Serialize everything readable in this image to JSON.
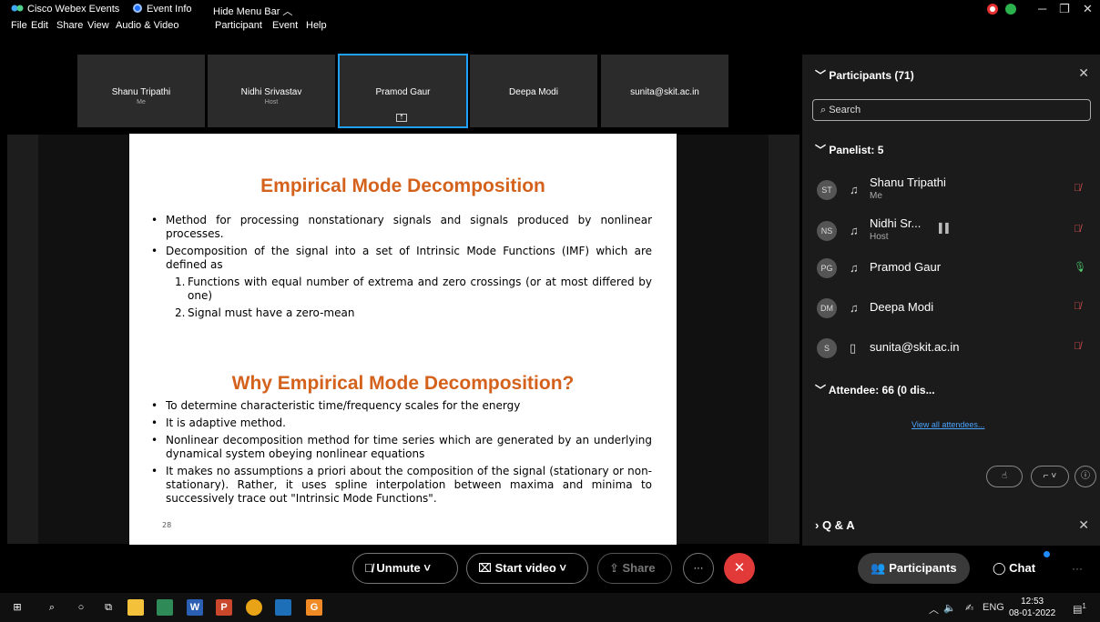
{
  "titlebar": {
    "app_title": "Cisco Webex Events",
    "event_info": "Event Info",
    "hide_menu": "Hide Menu Bar ︿"
  },
  "menu": [
    "File",
    "Edit",
    "Share",
    "View",
    "Audio & Video",
    "Participant",
    "Event",
    "Help"
  ],
  "tiles": [
    {
      "name": "Shanu Tripathi",
      "sub": "Me"
    },
    {
      "name": "Nidhi Srivastav",
      "sub": "Host"
    },
    {
      "name": "Pramod Gaur",
      "sub": ""
    },
    {
      "name": "Deepa Modi",
      "sub": ""
    },
    {
      "name": "sunita@skit.ac.in",
      "sub": ""
    }
  ],
  "slide": {
    "title1": "Empirical Mode Decomposition",
    "bullets1": [
      "Method for processing nonstationary signals and signals produced by nonlinear processes.",
      "Decomposition of the signal into a set of  Intrinsic Mode Functions (IMF) which are defined as"
    ],
    "numbered": [
      {
        "n": "1.",
        "text": "Functions with equal number of extrema and zero crossings (or at most differed by one)"
      },
      {
        "n": "2.",
        "text": "Signal must have a zero-mean"
      }
    ],
    "title2": "Why Empirical Mode Decomposition?",
    "bullets2": [
      "To determine characteristic time/frequency scales for the energy",
      "It is adaptive method.",
      "Nonlinear decomposition method for time series which are generated by an underlying dynamical system obeying nonlinear equations",
      "It makes no assumptions a priori about the composition of the signal (stationary or non-stationary). Rather, it uses spline interpolation between maxima and minima to successively trace out \"Intrinsic Mode Functions\"."
    ],
    "page_number": "28"
  },
  "toolbar": {
    "unmute": "Unmute",
    "start_video": "Start video",
    "share": "Share",
    "participants": "Participants",
    "chat": "Chat"
  },
  "panel": {
    "header": "Participants (71)",
    "search_placeholder": "Search",
    "panelist_header": "Panelist: 5",
    "panelists": [
      {
        "initials": "ST",
        "name": "Shanu Tripathi",
        "role": "Me",
        "mic": "muted"
      },
      {
        "initials": "NS",
        "name": "Nidhi Sr...",
        "role": "Host",
        "mic": "muted"
      },
      {
        "initials": "PG",
        "name": "Pramod Gaur",
        "role": "",
        "mic": "on"
      },
      {
        "initials": "DM",
        "name": "Deepa Modi",
        "role": "",
        "mic": "muted"
      },
      {
        "initials": "S",
        "name": "sunita@skit.ac.in",
        "role": "",
        "mic": "muted"
      }
    ],
    "attendee_header": "Attendee: 66 (0 dis...",
    "view_all": "View all attendees..."
  },
  "qa": {
    "label": "Q & A"
  },
  "taskbar": {
    "lang": "ENG",
    "time": "12:53",
    "date": "08-01-2022",
    "notif_count": "1"
  },
  "colors": {
    "accent": "#1fa2ff",
    "end_call": "#e23939",
    "slide_title": "#d4621c",
    "muted": "#e05050",
    "unmuted": "#4cc46b"
  }
}
